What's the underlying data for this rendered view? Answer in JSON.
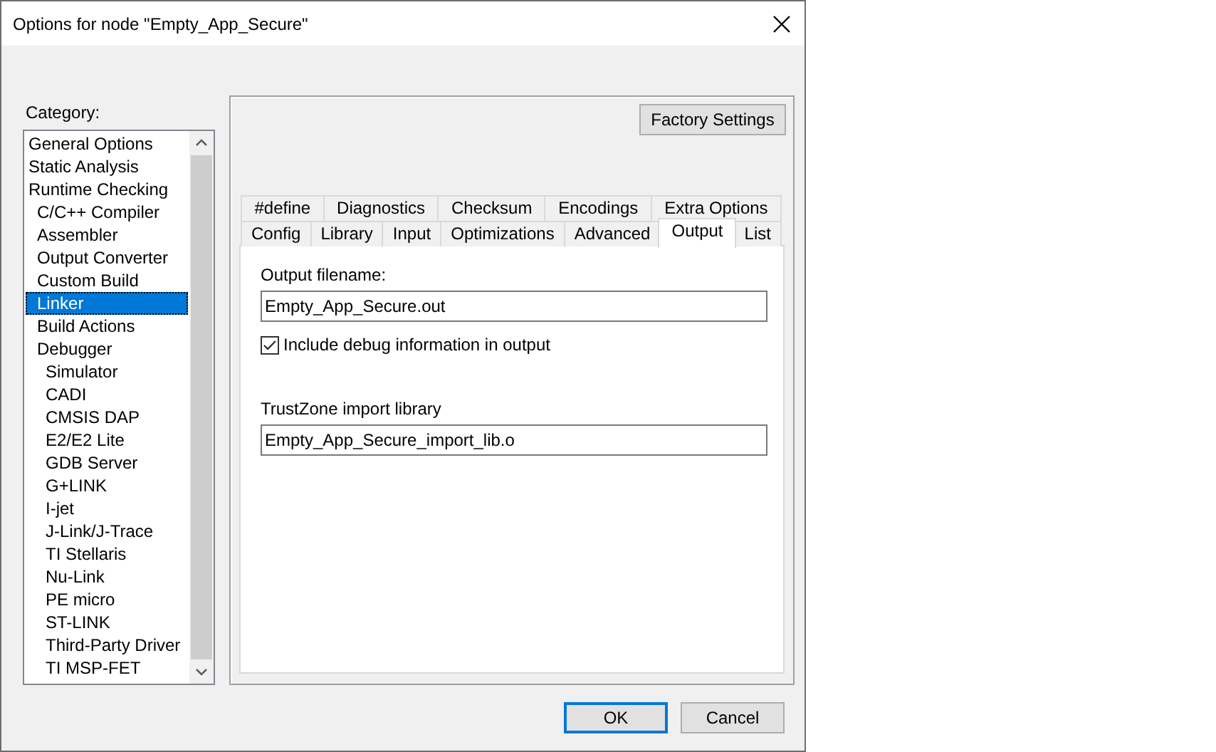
{
  "window": {
    "title": "Options for node \"Empty_App_Secure\""
  },
  "category": {
    "label": "Category:",
    "items": [
      {
        "label": "General Options",
        "selected": false
      },
      {
        "label": "Static Analysis",
        "selected": false
      },
      {
        "label": "Runtime Checking",
        "selected": false,
        "children": [
          {
            "label": "C/C++ Compiler",
            "selected": false
          },
          {
            "label": "Assembler",
            "selected": false
          },
          {
            "label": "Output Converter",
            "selected": false
          },
          {
            "label": "Custom Build",
            "selected": false
          },
          {
            "label": "Linker",
            "selected": true
          },
          {
            "label": "Build Actions",
            "selected": false
          },
          {
            "label": "Debugger",
            "selected": false,
            "children": [
              {
                "label": "Simulator",
                "selected": false
              },
              {
                "label": "CADI",
                "selected": false
              },
              {
                "label": "CMSIS DAP",
                "selected": false
              },
              {
                "label": "E2/E2 Lite",
                "selected": false
              },
              {
                "label": "GDB Server",
                "selected": false
              },
              {
                "label": "G+LINK",
                "selected": false
              },
              {
                "label": "I-jet",
                "selected": false
              },
              {
                "label": "J-Link/J-Trace",
                "selected": false
              },
              {
                "label": "TI Stellaris",
                "selected": false
              },
              {
                "label": "Nu-Link",
                "selected": false
              },
              {
                "label": "PE micro",
                "selected": false
              },
              {
                "label": "ST-LINK",
                "selected": false
              },
              {
                "label": "Third-Party Driver",
                "selected": false
              },
              {
                "label": "TI MSP-FET",
                "selected": false
              }
            ]
          }
        ]
      }
    ]
  },
  "factory_settings": "Factory Settings",
  "tab_rows": [
    [
      {
        "label": "#define",
        "selected": false
      },
      {
        "label": "Diagnostics",
        "selected": false
      },
      {
        "label": "Checksum",
        "selected": false
      },
      {
        "label": "Encodings",
        "selected": false
      },
      {
        "label": "Extra Options",
        "selected": false
      }
    ],
    [
      {
        "label": "Config",
        "selected": false
      },
      {
        "label": "Library",
        "selected": false
      },
      {
        "label": "Input",
        "selected": false
      },
      {
        "label": "Optimizations",
        "selected": false
      },
      {
        "label": "Advanced",
        "selected": false
      },
      {
        "label": "Output",
        "selected": true
      },
      {
        "label": "List",
        "selected": false
      }
    ]
  ],
  "output_filename": {
    "label": "Output filename:",
    "value": "Empty_App_Secure.out"
  },
  "include_debug": {
    "label": "Include debug information in output",
    "checked": true
  },
  "trustzone": {
    "label": "TrustZone import library",
    "value": "Empty_App_Secure_import_lib.o"
  },
  "buttons": [
    {
      "label": "OK",
      "default": true
    },
    {
      "label": "Cancel",
      "default": false
    }
  ]
}
